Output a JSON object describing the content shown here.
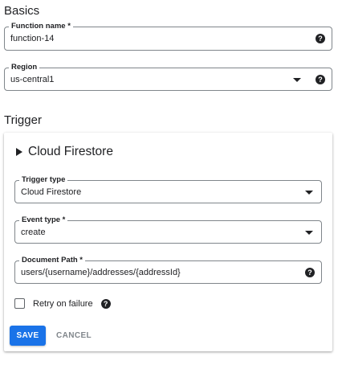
{
  "basics": {
    "title": "Basics",
    "function_name": {
      "label": "Function name *",
      "value": "function-14",
      "help_icon": "help-icon"
    },
    "region": {
      "label": "Region",
      "value": "us-central1",
      "dropdown_icon": "dropdown-arrow-icon",
      "help_icon": "help-icon"
    }
  },
  "trigger": {
    "title": "Trigger",
    "card": {
      "header": "Cloud Firestore",
      "trigger_type": {
        "label": "Trigger type",
        "value": "Cloud Firestore"
      },
      "event_type": {
        "label": "Event type *",
        "value": "create"
      },
      "document_path": {
        "label": "Document Path *",
        "value": "users/{username}/addresses/{addressId}"
      },
      "retry": {
        "label": "Retry on failure",
        "checked": false
      },
      "save_label": "SAVE",
      "cancel_label": "CANCEL"
    }
  },
  "colors": {
    "accent": "#1a73e8",
    "text": "#202124",
    "border": "#80868b",
    "disabled_text": "#80868b"
  }
}
